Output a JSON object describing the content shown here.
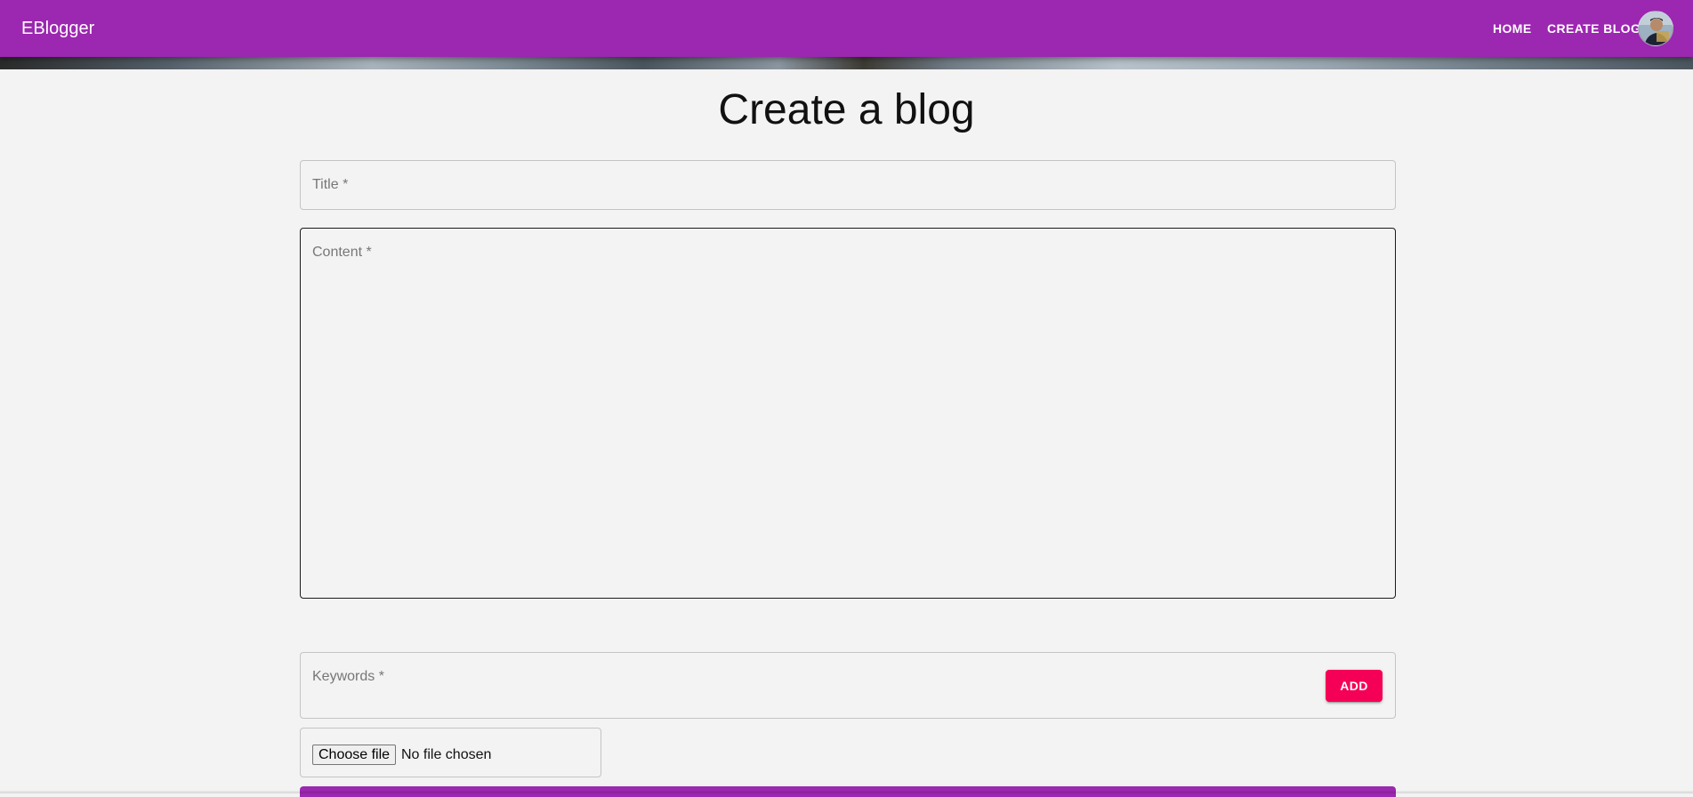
{
  "appbar": {
    "brand": "EBlogger",
    "nav": {
      "home": "HOME",
      "create_blog": "CREATE BLOG"
    },
    "avatar_icon": "user-avatar",
    "background_color": "#9c27b0"
  },
  "main": {
    "title": "Create a blog",
    "fields": {
      "title_label": "Title *",
      "content_label": "Content *",
      "keywords_label": "Keywords *"
    },
    "add_button": "ADD",
    "file": {
      "button": "Choose file",
      "status": "No file chosen"
    },
    "colors": {
      "accent": "#f50057",
      "primary": "#9c27b0"
    }
  }
}
